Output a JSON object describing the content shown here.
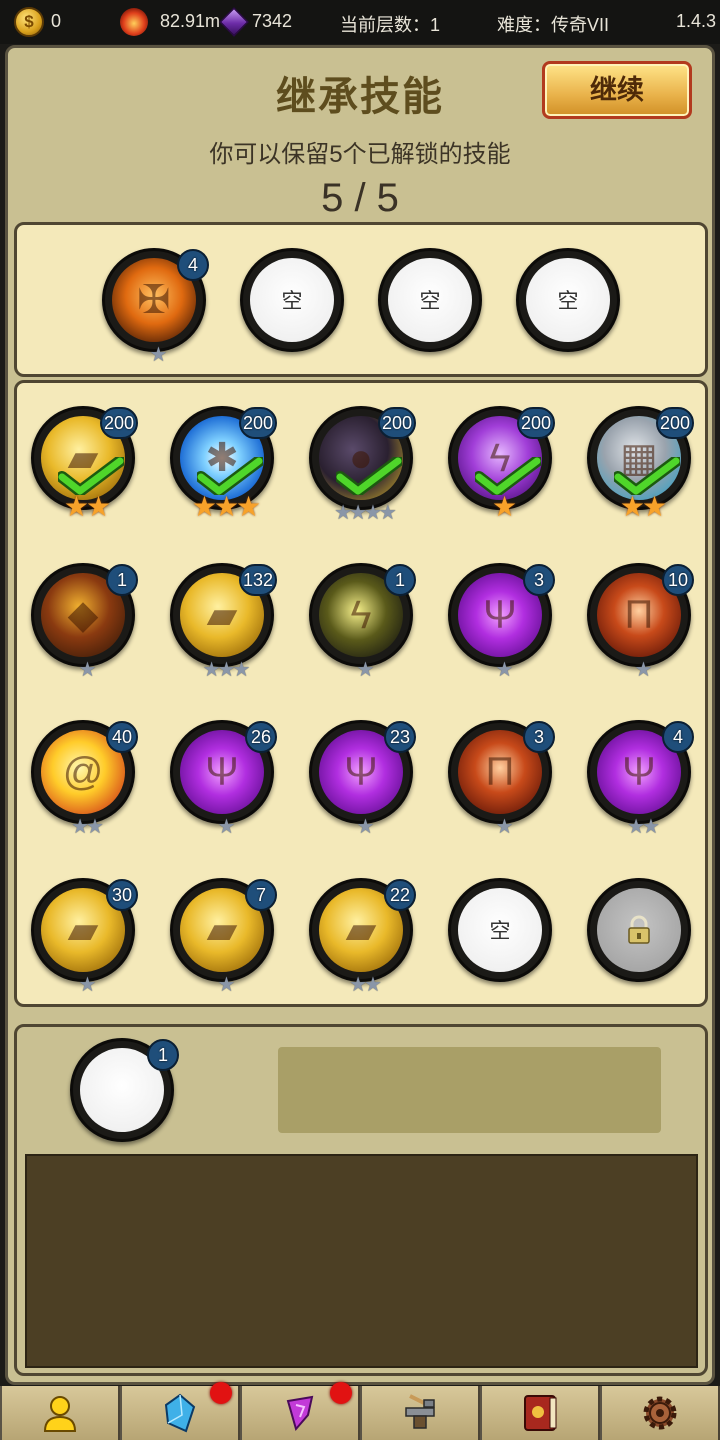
{
  "topbar": {
    "gold": "0",
    "fire": "82.91m",
    "gems": "7342",
    "floor": "当前层数：1",
    "difficulty": "难度：传奇VII",
    "version": "1.4.3"
  },
  "header": {
    "title": "继承技能",
    "continue_label": "继续",
    "subtitle": "你可以保留5个已解锁的技能",
    "count": "5 / 5"
  },
  "selected": [
    {
      "icon": "holy-cross-icon",
      "badge": "4",
      "stars": 1,
      "star_type": "grey"
    },
    {
      "empty_label": "空"
    },
    {
      "empty_label": "空"
    },
    {
      "empty_label": "空"
    }
  ],
  "skills": [
    {
      "icon": "gold-tome-icon",
      "badge": "200",
      "stars": 2,
      "star_type": "gold",
      "checked": true
    },
    {
      "icon": "ice-crystal-icon",
      "badge": "200",
      "stars": 3,
      "star_type": "gold",
      "checked": true
    },
    {
      "icon": "dark-cloud-icon",
      "badge": "200",
      "stars": 4,
      "star_type": "grey",
      "checked": true
    },
    {
      "icon": "purple-lightning-icon",
      "badge": "200",
      "stars": 1,
      "star_type": "gold",
      "checked": true
    },
    {
      "icon": "stone-wall-icon",
      "badge": "200",
      "stars": 2,
      "star_type": "gold",
      "checked": true
    },
    {
      "icon": "lava-rock-icon",
      "badge": "1",
      "stars": 1,
      "star_type": "grey"
    },
    {
      "icon": "gold-tome-icon",
      "badge": "132",
      "stars": 3,
      "star_type": "grey"
    },
    {
      "icon": "yellow-lightning-icon",
      "badge": "1",
      "stars": 1,
      "star_type": "grey"
    },
    {
      "icon": "purple-claw-icon",
      "badge": "3",
      "stars": 1,
      "star_type": "grey"
    },
    {
      "icon": "red-pillar-icon",
      "badge": "10",
      "stars": 1,
      "star_type": "grey"
    },
    {
      "icon": "fire-swirl-icon",
      "badge": "40",
      "stars": 2,
      "star_type": "grey"
    },
    {
      "icon": "purple-claw-icon",
      "badge": "26",
      "stars": 1,
      "star_type": "grey"
    },
    {
      "icon": "purple-claw-icon",
      "badge": "23",
      "stars": 1,
      "star_type": "grey"
    },
    {
      "icon": "red-pillar-icon",
      "badge": "3",
      "stars": 1,
      "star_type": "grey"
    },
    {
      "icon": "purple-claw-icon",
      "badge": "4",
      "stars": 2,
      "star_type": "grey"
    },
    {
      "icon": "gold-tome-icon",
      "badge": "30",
      "stars": 1,
      "star_type": "grey"
    },
    {
      "icon": "gold-tome-icon",
      "badge": "7",
      "stars": 1,
      "star_type": "grey"
    },
    {
      "icon": "gold-tome-icon",
      "badge": "22",
      "stars": 2,
      "star_type": "grey"
    },
    {
      "empty_label": "空"
    },
    {
      "locked": true,
      "icon": "padlock-icon"
    }
  ],
  "detail": {
    "badge": "1"
  },
  "bottom_nav": [
    {
      "icon": "hero-icon",
      "alert": false
    },
    {
      "icon": "crystal-icon",
      "alert": true
    },
    {
      "icon": "purple-rune-icon",
      "alert": true
    },
    {
      "icon": "anvil-forge-icon",
      "alert": false
    },
    {
      "icon": "spellbook-icon",
      "alert": false
    },
    {
      "icon": "cog-settings-icon",
      "alert": false
    }
  ]
}
